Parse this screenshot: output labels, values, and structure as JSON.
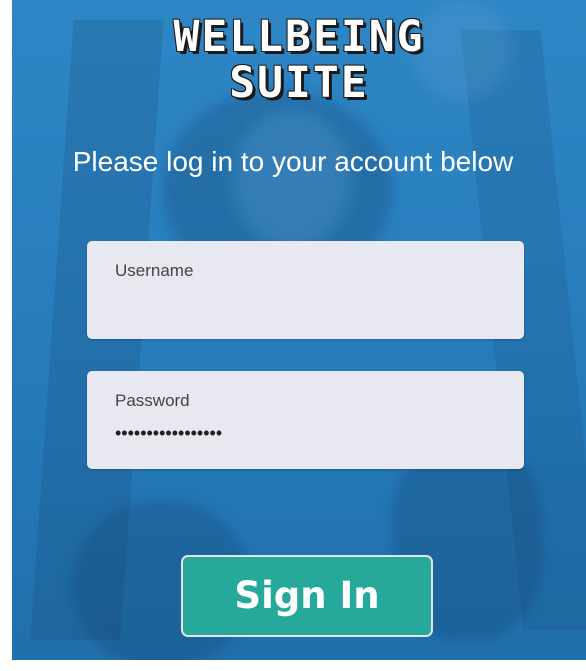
{
  "app": {
    "logo_line1": "WELLBEING",
    "logo_line2": "SUITE",
    "subtitle": "Please log in to your account below"
  },
  "form": {
    "username": {
      "label": "Username",
      "value": ""
    },
    "password": {
      "label": "Password",
      "value": "•••••••••••••••••"
    },
    "submit_label": "Sign In"
  },
  "colors": {
    "background": "#2a80bf",
    "field_background": "#e8e8f0",
    "button": "#26a99a",
    "button_border": "#e3e3e3",
    "text_light": "#ffffff"
  }
}
